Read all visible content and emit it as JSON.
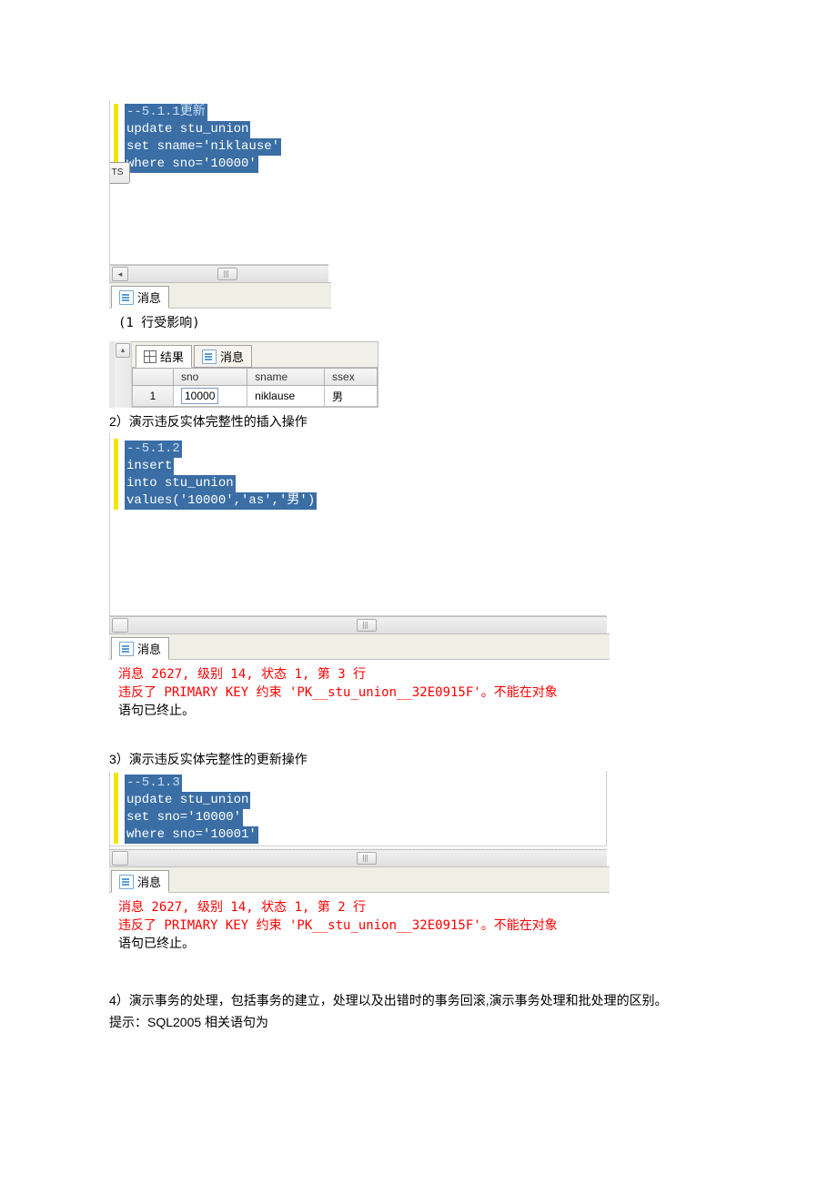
{
  "block1": {
    "ts_label": "TS",
    "code": {
      "l1": "--5.1.1更新",
      "l2": "update stu_union",
      "l3": "set sname='niklause'",
      "l4": "where sno='10000'"
    },
    "msg_tab": "消息",
    "output": "(1 行受影响)",
    "result_tabs": {
      "results": "结果",
      "messages": "消息"
    },
    "table": {
      "headers": {
        "c1": "sno",
        "c2": "sname",
        "c3": "ssex"
      },
      "row1": {
        "idx": "1",
        "c1": "10000",
        "c2": "niklause",
        "c3": "男"
      }
    }
  },
  "section2_title": "2）演示违反实体完整性的插入操作",
  "block2": {
    "code": {
      "l1": "--5.1.2",
      "l2": "insert",
      "l3": "into stu_union",
      "l4": "values('10000','as','男')"
    },
    "msg_tab": "消息",
    "error_line1": "消息 2627, 级别 14, 状态 1, 第 3 行",
    "error_line2": "违反了 PRIMARY KEY 约束 'PK__stu_union__32E0915F'。不能在对象",
    "text_line": "语句已终止。"
  },
  "section3_title": "3）演示违反实体完整性的更新操作",
  "block3": {
    "code": {
      "l1": "--5.1.3",
      "l2": "update stu_union",
      "l3": "set sno='10000'",
      "l4": "where sno='10001'"
    },
    "msg_tab": "消息",
    "error_line1": "消息 2627, 级别 14, 状态 1, 第 2 行",
    "error_line2": "违反了 PRIMARY KEY 约束 'PK__stu_union__32E0915F'。不能在对象",
    "text_line": "语句已终止。"
  },
  "section4": {
    "p1": "4）演示事务的处理，包括事务的建立，处理以及出错时的事务回滚,演示事务处理和批处理的区别。",
    "p2": "提示：SQL2005 相关语句为"
  }
}
